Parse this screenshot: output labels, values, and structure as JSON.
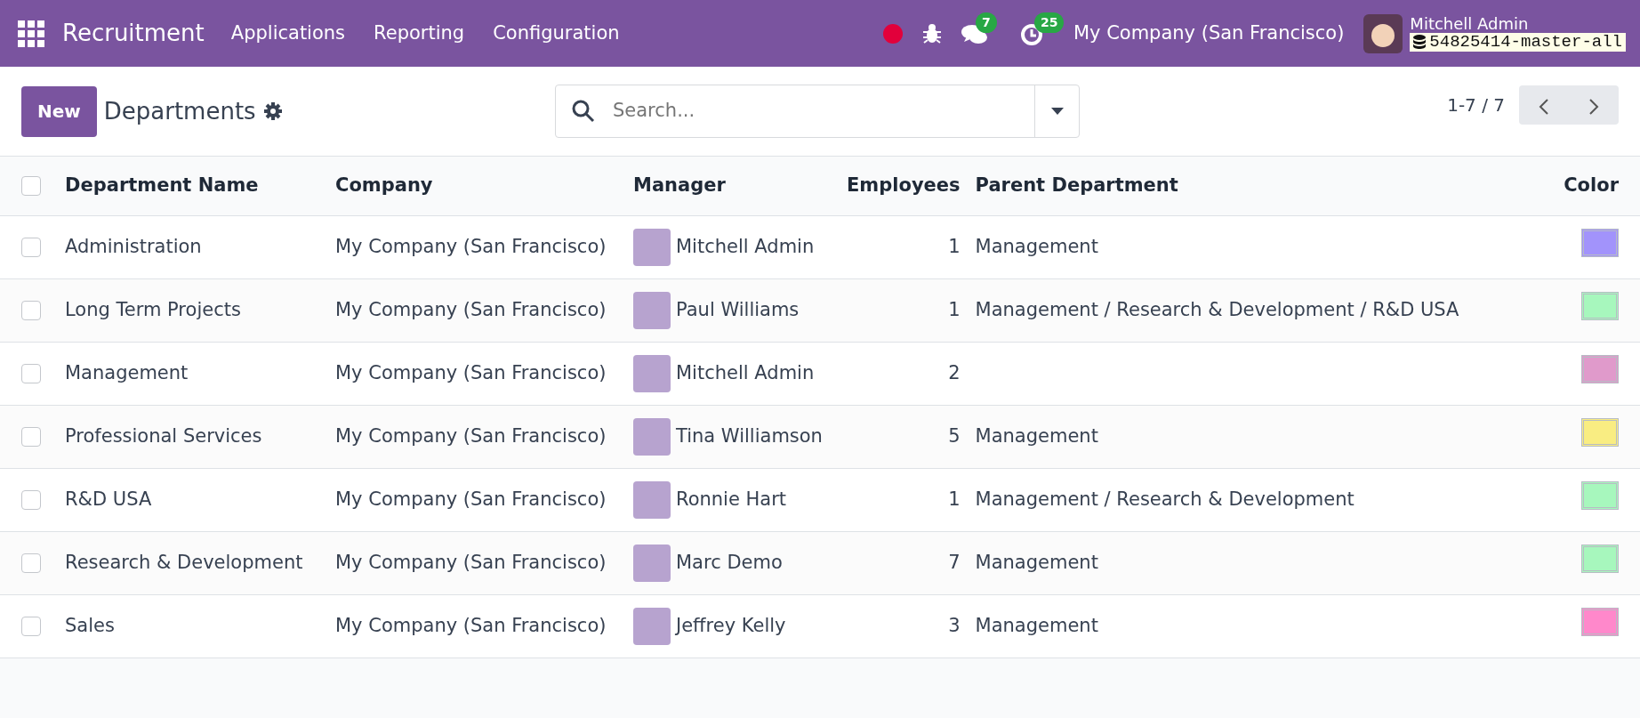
{
  "navbar": {
    "app_name": "Recruitment",
    "menus": [
      "Applications",
      "Reporting",
      "Configuration"
    ],
    "messages_count": "7",
    "activities_count": "25",
    "company": "My Company (San Francisco)",
    "user_name": "Mitchell Admin",
    "database": "54825414-master-all"
  },
  "control_panel": {
    "new_button": "New",
    "title": "Departments",
    "search": {
      "placeholder": "Search..."
    },
    "pager": "1-7 / 7"
  },
  "table": {
    "select_all_checked": false,
    "columns": [
      "Department Name",
      "Company",
      "Manager",
      "Employees",
      "Parent Department",
      "Color"
    ],
    "rows": [
      {
        "name": "Administration",
        "company": "My Company (San Francisco)",
        "manager": "Mitchell Admin",
        "employees": "1",
        "parent": "Management",
        "color": "#a293fb",
        "checked": false
      },
      {
        "name": "Long Term Projects",
        "company": "My Company (San Francisco)",
        "manager": "Paul Williams",
        "employees": "1",
        "parent": "Management / Research & Development / R&D USA",
        "color": "#a7f7bd",
        "checked": false
      },
      {
        "name": "Management",
        "company": "My Company (San Francisco)",
        "manager": "Mitchell Admin",
        "employees": "2",
        "color": "#e09acb",
        "checked": false
      },
      {
        "name": "Professional Services",
        "company": "My Company (San Francisco)",
        "manager": "Tina Williamson",
        "employees": "5",
        "parent": "Management",
        "color": "#f9ed82",
        "checked": false
      },
      {
        "name": "R&D USA",
        "company": "My Company (San Francisco)",
        "manager": "Ronnie Hart",
        "employees": "1",
        "parent": "Management / Research & Development",
        "color": "#a7f7bd",
        "checked": false
      },
      {
        "name": "Research & Development",
        "company": "My Company (San Francisco)",
        "manager": "Marc Demo",
        "employees": "7",
        "parent": "Management",
        "color": "#a7f7bd",
        "checked": false
      },
      {
        "name": "Sales",
        "company": "My Company (San Francisco)",
        "manager": "Jeffrey Kelly",
        "employees": "3",
        "parent": "Management",
        "color": "#ff88cb",
        "checked": false
      }
    ]
  }
}
